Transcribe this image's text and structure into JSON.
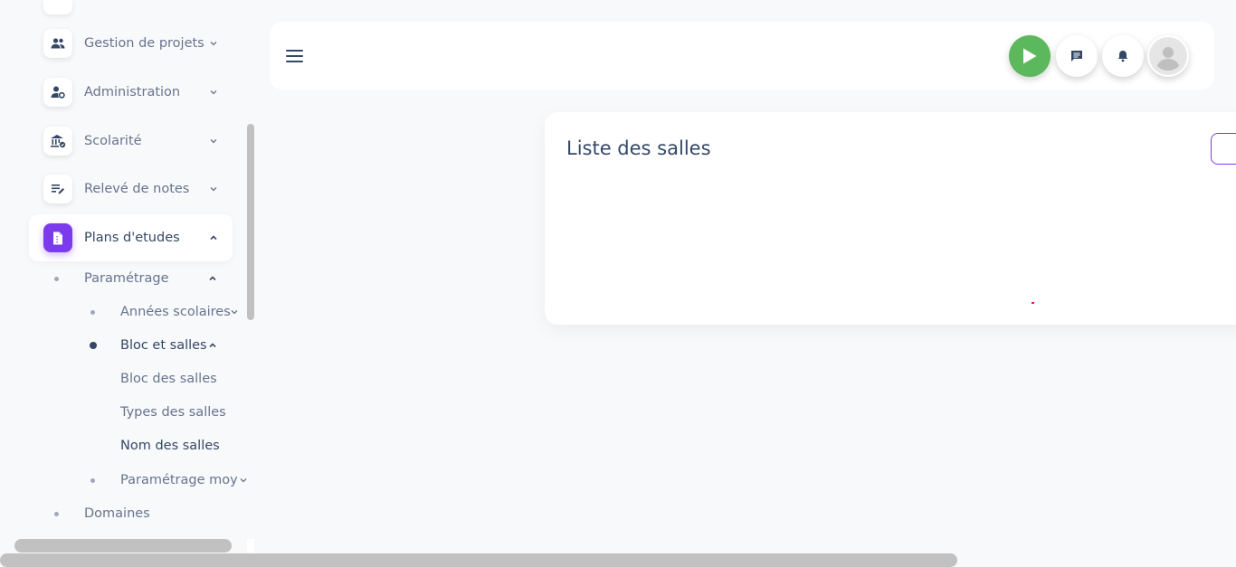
{
  "sidebar": {
    "items": [
      {
        "label": "Gestion de projets",
        "icon": "group-icon",
        "expanded": false
      },
      {
        "label": "Administration",
        "icon": "user-settings-icon",
        "expanded": false
      },
      {
        "label": "Scolarité",
        "icon": "school-building-icon",
        "expanded": false
      },
      {
        "label": "Relevé de notes",
        "icon": "edit-list-icon",
        "expanded": false
      },
      {
        "label": "Plans d'etudes",
        "icon": "document-icon",
        "expanded": true,
        "active": true
      }
    ],
    "sub": {
      "parametrage": "Paramétrage",
      "annees_scolaires": "Années scolaires",
      "bloc_et_salles": "Bloc et salles",
      "bloc_des_salles": "Bloc des salles",
      "types_des_salles": "Types des salles",
      "nom_des_salles": "Nom des salles",
      "parametrage_moy": "Paramétrage moy",
      "domaines": "Domaines"
    }
  },
  "topbar": {
    "buttons": [
      "menu-icon",
      "play-icon",
      "chat-icon",
      "bell-icon",
      "avatar-icon"
    ]
  },
  "main": {
    "title": "Liste des salles"
  },
  "colors": {
    "accent": "#7c3aed",
    "play": "#5cb85c",
    "text": "#344767",
    "muted": "#67748e"
  }
}
